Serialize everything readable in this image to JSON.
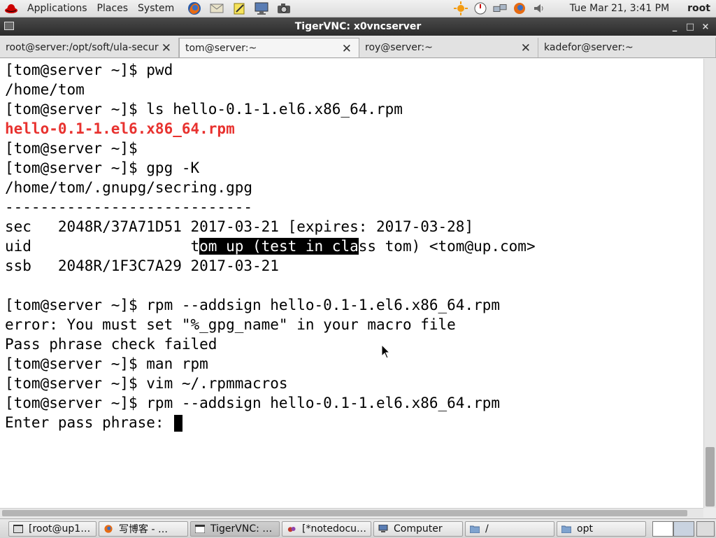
{
  "top_panel": {
    "menus": [
      "Applications",
      "Places",
      "System"
    ],
    "launchers": [
      "firefox-icon",
      "mail-icon",
      "notes-icon",
      "monitor-icon",
      "camera-icon"
    ],
    "tray": [
      "weather-icon",
      "gauge-icon",
      "network-icon",
      "firefox-small-icon",
      "volume-icon"
    ],
    "clock": "Tue Mar 21,  3:41 PM",
    "user": "root"
  },
  "window": {
    "title": "TigerVNC: x0vncserver",
    "controls": [
      "_",
      "□",
      "×"
    ]
  },
  "tabs": [
    {
      "label": "root@server:/opt/soft/ula-secur…",
      "close": "✕"
    },
    {
      "label": "tom@server:~",
      "close": "✕",
      "active": true
    },
    {
      "label": "roy@server:~",
      "close": "✕"
    },
    {
      "label": "kadefor@server:~",
      "close": ""
    }
  ],
  "terminal": {
    "l1": "[tom@server ~]$ pwd",
    "l2": "/home/tom",
    "l3": "[tom@server ~]$ ls hello-0.1-1.el6.x86_64.rpm",
    "l4": "hello-0.1-1.el6.x86_64.rpm",
    "l5": "[tom@server ~]$",
    "l6": "[tom@server ~]$ gpg -K",
    "l7": "/home/tom/.gnupg/secring.gpg",
    "l8": "----------------------------",
    "l9": "sec   2048R/37A71D51 2017-03-21 [expires: 2017-03-28]",
    "l10_a": "uid                  t",
    "l10_sel": "om up (test in cla",
    "l10_b": "ss tom) <tom@up.com>",
    "l11": "ssb   2048R/1F3C7A29 2017-03-21",
    "l12": "",
    "l13": "[tom@server ~]$ rpm --addsign hello-0.1-1.el6.x86_64.rpm",
    "l14": "error: You must set \"%_gpg_name\" in your macro file",
    "l15": "Pass phrase check failed",
    "l16": "[tom@server ~]$ man rpm",
    "l17": "[tom@server ~]$ vim ~/.rpmmacros",
    "l18": "[tom@server ~]$ rpm --addsign hello-0.1-1.el6.x86_64.rpm",
    "l19": "Enter pass phrase: "
  },
  "taskbar": [
    {
      "label": "[root@up1…",
      "icon": "terminal-icon"
    },
    {
      "label": "写博客 - …",
      "icon": "firefox-icon"
    },
    {
      "label": "TigerVNC: …",
      "icon": "window-icon",
      "active": true
    },
    {
      "label": "[*notedocu…",
      "icon": "notes-icon"
    },
    {
      "label": "Computer",
      "icon": "computer-icon"
    },
    {
      "label": "/",
      "icon": "folder-icon"
    },
    {
      "label": "opt",
      "icon": "folder-icon"
    }
  ],
  "colors": {
    "terminal_bg": "#ffffff",
    "rpm_file_red": "#e8322f",
    "titlebar": "#2b2b2b"
  }
}
